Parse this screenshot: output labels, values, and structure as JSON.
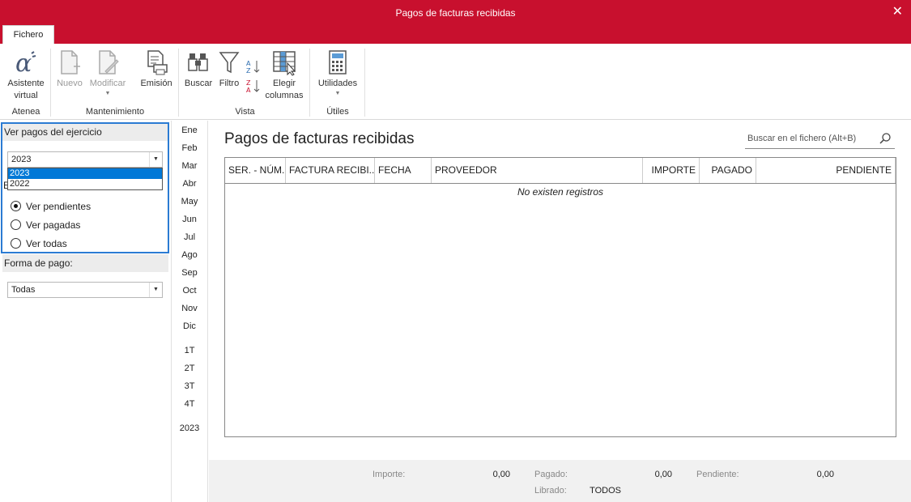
{
  "window": {
    "title": "Pagos de facturas recibidas",
    "close_glyph": "✕"
  },
  "ribbon": {
    "tab": "Fichero",
    "buttons": {
      "asistente": {
        "line1": "Asistente",
        "line2": "virtual"
      },
      "nuevo": "Nuevo",
      "modificar": "Modificar",
      "emision": "Emisión",
      "buscar": "Buscar",
      "filtro": "Filtro",
      "elegir": {
        "line1": "Elegir",
        "line2": "columnas"
      },
      "utilidades": "Utilidades"
    },
    "groups": {
      "atenea": "Atenea",
      "mantenimiento": "Mantenimiento",
      "vista": "Vista",
      "utiles": "Útiles"
    }
  },
  "left": {
    "ejercicio_label": "Ver pagos del ejercicio",
    "ejercicio_value": "2023",
    "ejercicio_options": [
      "2023",
      "2022"
    ],
    "estado_label_fragment": "E",
    "radios": [
      {
        "label": "Ver pendientes",
        "checked": true
      },
      {
        "label": "Ver pagadas",
        "checked": false
      },
      {
        "label": "Ver todas",
        "checked": false
      }
    ],
    "forma_label": "Forma de pago:",
    "forma_value": "Todas"
  },
  "periods": {
    "months": [
      "Ene",
      "Feb",
      "Mar",
      "Abr",
      "May",
      "Jun",
      "Jul",
      "Ago",
      "Sep",
      "Oct",
      "Nov",
      "Dic"
    ],
    "quarters": [
      "1T",
      "2T",
      "3T",
      "4T"
    ],
    "year": "2023"
  },
  "main": {
    "heading": "Pagos de facturas recibidas",
    "search_placeholder": "Buscar en el fichero (Alt+B)",
    "columns": [
      "SER. - NÚM.",
      "FACTURA RECIBI...",
      "FECHA",
      "PROVEEDOR",
      "IMPORTE",
      "PAGADO",
      "PENDIENTE"
    ],
    "empty_message": "No existen registros"
  },
  "totals": {
    "importe_label": "Importe:",
    "importe_value": "0,00",
    "pagado_label": "Pagado:",
    "pagado_value": "0,00",
    "pendiente_label": "Pendiente:",
    "pendiente_value": "0,00",
    "librado_label": "Librado:",
    "librado_value": "TODOS"
  },
  "colors": {
    "titlebar": "#c8102e",
    "focus": "#2b7bd3",
    "selection": "#0078d7"
  }
}
